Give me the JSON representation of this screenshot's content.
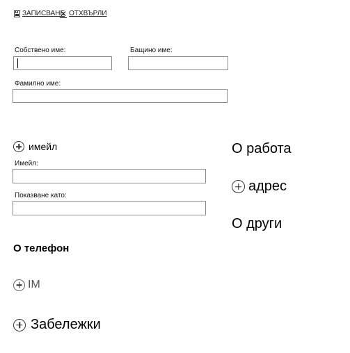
{
  "toolbar": {
    "save_label": "ЗАПИСВАНЕ",
    "cancel_label": "ОТХВЪРЛИ",
    "save_icon": "save-icon",
    "cancel_icon": "close-icon"
  },
  "name_fields": {
    "first_name_label": "Собствено име:",
    "middle_name_label": "Бащино име:",
    "last_name_label": "Фамилно име:",
    "first_name_value": "",
    "middle_name_value": "",
    "last_name_value": ""
  },
  "email_section": {
    "toggle_label": "имейл",
    "email_label": "Имейл:",
    "display_as_label": "Показване като:",
    "email_value": "",
    "display_as_value": ""
  },
  "sections": {
    "phone": "О телефон",
    "im": "IM",
    "notes": "Забележки",
    "work": "О работа",
    "address": "адрес",
    "other": "О други"
  },
  "colors": {
    "field_border": "#8a8a8a",
    "text": "#000000",
    "muted_text": "#555555"
  }
}
